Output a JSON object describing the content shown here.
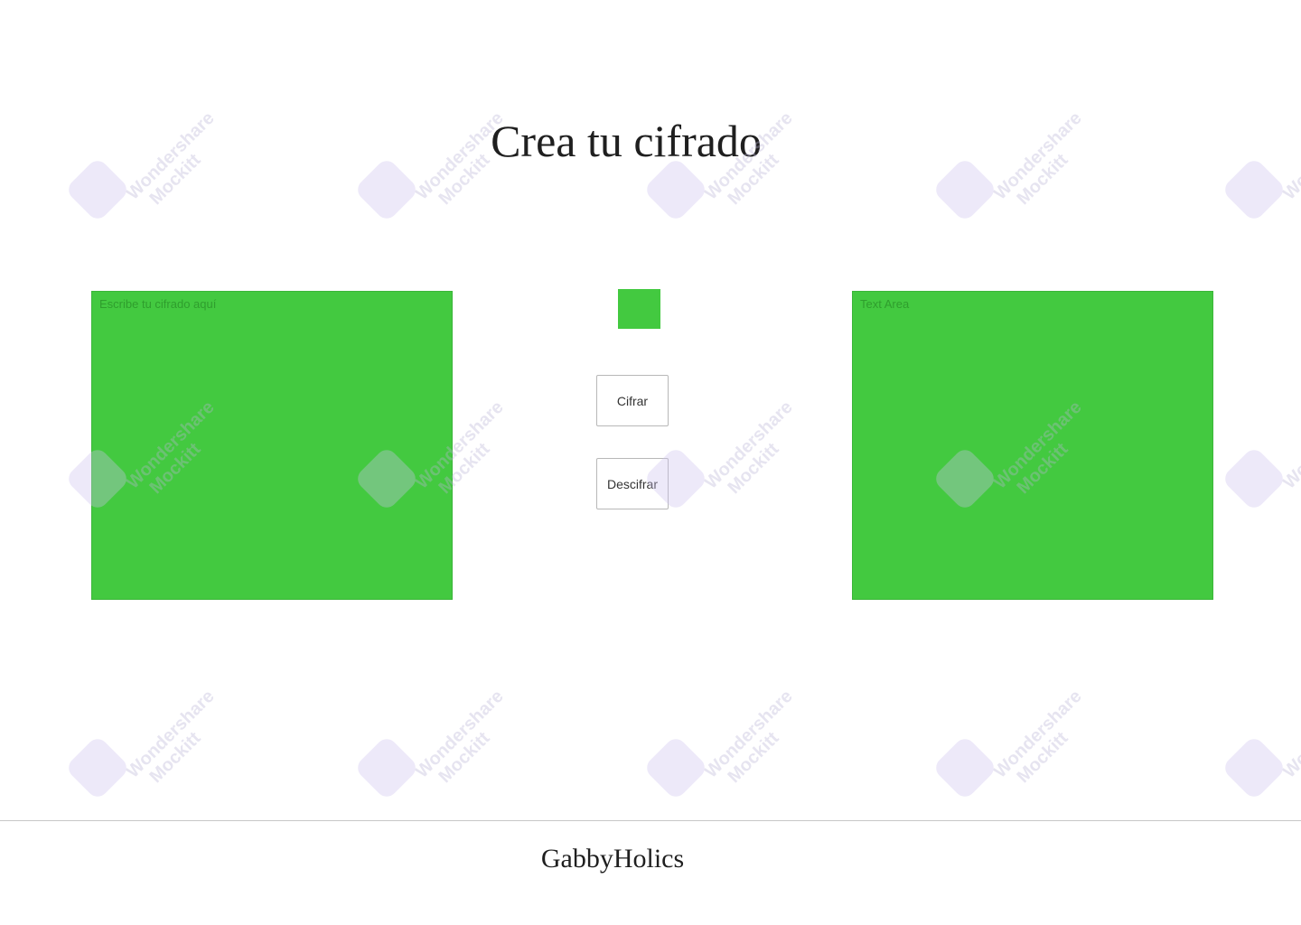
{
  "header": {
    "title": "Crea tu cifrado"
  },
  "input_area": {
    "placeholder": "Escribe tu cifrado aquí"
  },
  "output_area": {
    "placeholder": "Text Area"
  },
  "actions": {
    "encode_label": "Cifrar",
    "decode_label": "Descifrar"
  },
  "footer": {
    "text": "GabbyHolics"
  },
  "watermark": {
    "brand": "Wondershare",
    "product": "Mockitt"
  },
  "colors": {
    "accent_green": "#43c940",
    "watermark": "#cdc2ee"
  }
}
